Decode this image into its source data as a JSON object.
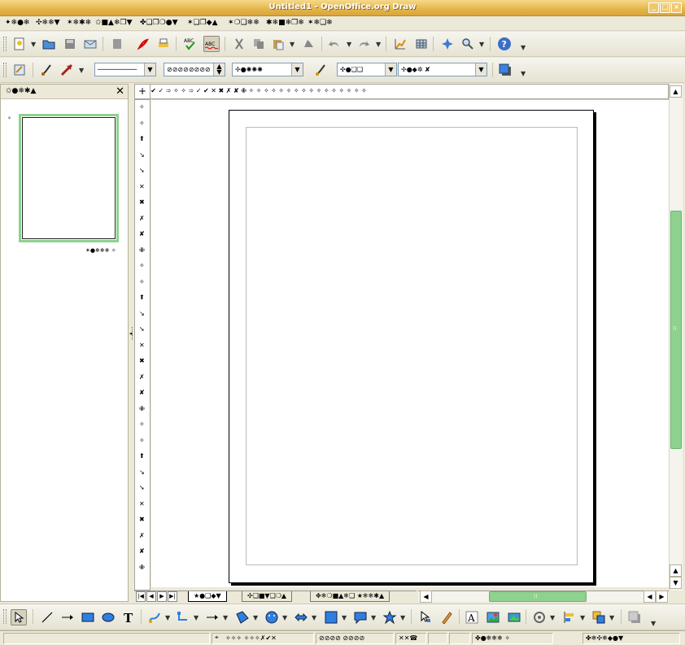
{
  "window": {
    "title": "Untitled1 - OpenOffice.org Draw"
  },
  "menu": [
    "✦❄●❄",
    "✣❄❄▼",
    "✶❄✱❄",
    "✩■▲❄❒▼",
    "✤❑❒❍●▼",
    "✶❑❒◆▲",
    "✶❍❑❄❄",
    "✱❄■❄❒❄",
    "✶❄❑❄"
  ],
  "toolbar_std": {
    "icons": [
      "new-icon",
      "open-icon",
      "save-icon",
      "email-icon",
      "edit-file-icon",
      "pdf-icon",
      "print-icon",
      "spellcheck-icon",
      "autospell-icon",
      "cut-icon",
      "copy-icon",
      "paste-icon",
      "clone-format-icon",
      "undo-icon",
      "redo-icon",
      "chart-icon",
      "table-icon",
      "navigator-icon",
      "zoom-icon",
      "help-icon"
    ]
  },
  "toolbar_lines": {
    "line_style_value": "──────────",
    "line_width_value": "⊘⊘⊘⊘⊘⊘⊘⊘",
    "line_color_value": "✢●✺✺✺",
    "area_style_value": "✣●❑❑",
    "area_fill_value": "✢●◆✲ ✘"
  },
  "pages_panel": {
    "title": "✩●❄✱▲",
    "close": "✕",
    "slide_label": "✶●❄❄❄ ✧",
    "slide_number": "✧"
  },
  "ruler_h": "✕  ✔  ✓  ➾  ✧         ✧      ➾    ✓    ✔    ✕    ✖    ✗    ✘    ✙    ✧ ✧ ✧ ✧ ✧ ✧ ✧ ✧ ✧ ✧ ✧ ✧ ✧ ✧ ✧ ✧",
  "ruler_v": [
    "✧",
    "✧",
    "⬆",
    "↘",
    "➘",
    "✕",
    "✖",
    "✗",
    "✘",
    "✙",
    "✧",
    "✧",
    "⬆",
    "↘",
    "➘",
    "✕",
    "✖",
    "✗",
    "✘",
    "✙",
    "✧",
    "✧",
    "⬆",
    "↘",
    "➘",
    "✕",
    "✖",
    "✗",
    "✘",
    "✙"
  ],
  "layer_tabs": [
    "★●❑◆▼",
    "✣❑■▼❑❍▲",
    "✥❄❍■▲❄❑ ★❄❄✱▲"
  ],
  "drawbar": {
    "icons": [
      "select-icon",
      "line-icon",
      "arrow-line-icon",
      "rectangle-icon",
      "ellipse-icon",
      "text-icon",
      "curve-icon",
      "connector-icon",
      "lines-arrows-icon",
      "basic-shapes-icon",
      "symbol-shapes-icon",
      "block-arrows-icon",
      "flowchart-icon",
      "callouts-icon",
      "stars-icon",
      "points-icon",
      "glue-points-icon",
      "fontwork-icon",
      "from-file-icon",
      "gallery-icon",
      "rotate-icon",
      "align-icon",
      "arrange-icon",
      "shadow-icon"
    ]
  },
  "status": {
    "position": "✧✧✧ ✧✧✧✗✔✕",
    "size": "⊘⊘⊘⊘ ⊘⊘⊘⊘",
    "zoom": "✕✕☎",
    "page": "✤●❄❄❄ ✧",
    "layout": "✤❄✣❄◆●▼"
  },
  "colors": {
    "accent": "#8fd18f",
    "titlebar": "#e3b54a"
  }
}
